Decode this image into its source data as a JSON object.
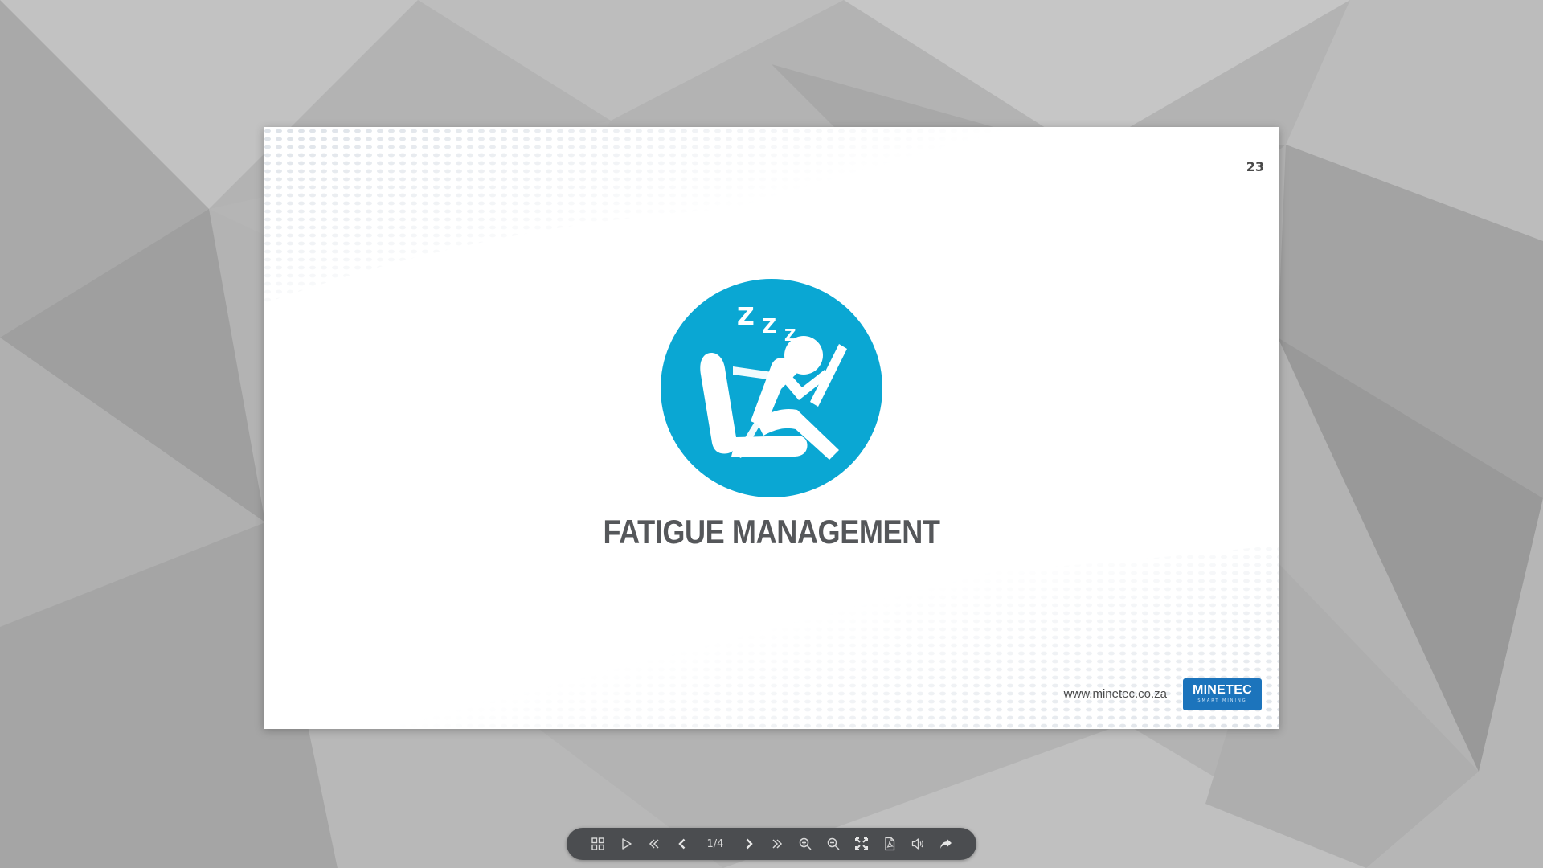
{
  "slide": {
    "page_number": "23",
    "title": "FATIGUE MANAGEMENT",
    "website": "www.minetec.co.za",
    "logo": {
      "name": "MINETEC",
      "tagline": "SMART MINING"
    },
    "icon": "sleeping-driver-icon",
    "icon_text": "Z Z Z",
    "accent_color": "#0aa7d3"
  },
  "toolbar": {
    "page_indicator": "1/4",
    "buttons": [
      "thumbnails-icon",
      "autoplay-icon",
      "first-page-icon",
      "previous-page-icon",
      "next-page-icon",
      "last-page-icon",
      "zoom-in-icon",
      "zoom-out-icon",
      "fullscreen-icon",
      "download-pdf-icon",
      "sound-icon",
      "share-icon"
    ]
  }
}
